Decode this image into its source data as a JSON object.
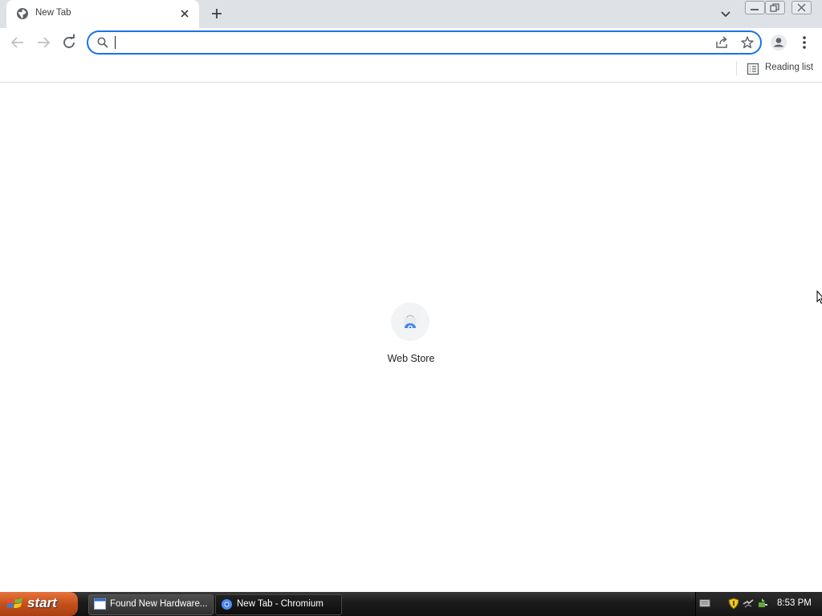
{
  "browser": {
    "tab": {
      "title": "New Tab"
    },
    "window_controls": [
      "minimize",
      "restore",
      "close"
    ],
    "toolbar": {
      "omnibox_value": "",
      "icons": [
        "back-icon",
        "forward-icon",
        "reload-icon",
        "search-icon",
        "share-icon",
        "star-icon",
        "profile-icon",
        "menu-icon"
      ]
    },
    "bookmarks_bar": {
      "reading_list_label": "Reading list"
    },
    "accent_color": "#1a73e8"
  },
  "newtab": {
    "shortcuts": [
      {
        "label": "Web Store"
      }
    ]
  },
  "taskbar": {
    "start_label": "start",
    "tasks": [
      {
        "label": "Found New Hardware..."
      },
      {
        "label": "New Tab - Chromium"
      }
    ],
    "clock": "8:53 PM"
  }
}
